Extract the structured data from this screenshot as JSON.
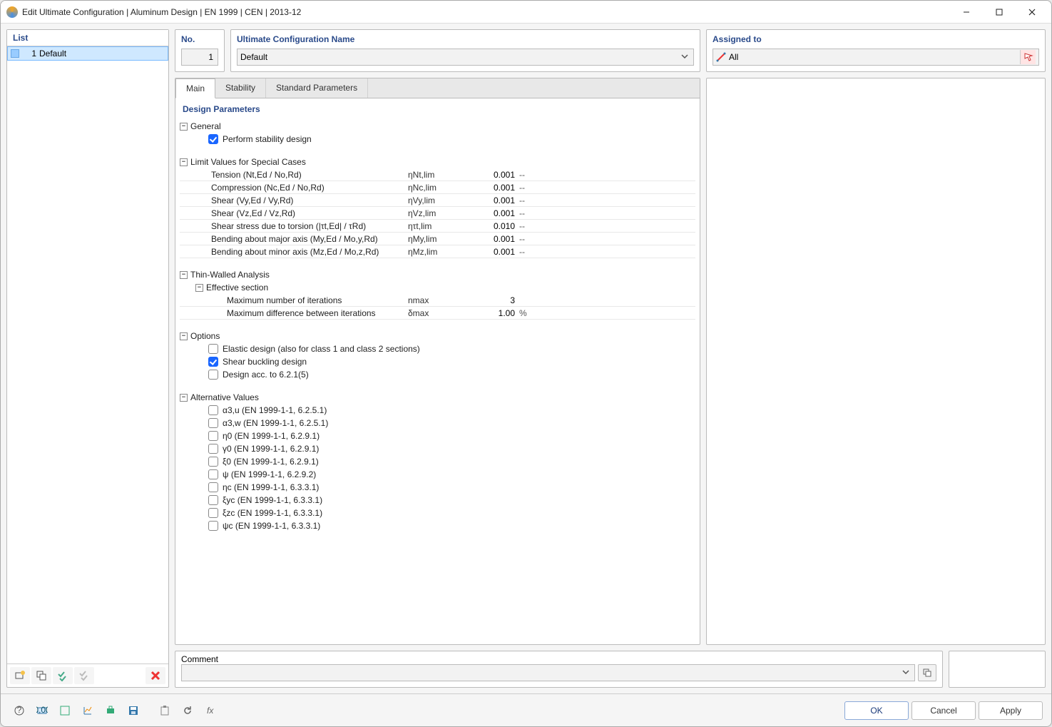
{
  "window": {
    "title": "Edit Ultimate Configuration | Aluminum Design | EN 1999 | CEN | 2013-12"
  },
  "left": {
    "header": "List",
    "items": [
      {
        "num": "1",
        "name": "Default",
        "selected": true
      }
    ]
  },
  "top": {
    "no_label": "No.",
    "no_value": "1",
    "name_label": "Ultimate Configuration Name",
    "name_value": "Default",
    "assigned_label": "Assigned to",
    "assigned_value": "All"
  },
  "tabs": [
    "Main",
    "Stability",
    "Standard Parameters"
  ],
  "params": {
    "title": "Design Parameters",
    "general": {
      "label": "General",
      "perform_stability": {
        "label": "Perform stability design",
        "checked": true
      }
    },
    "limit": {
      "label": "Limit Values for Special Cases",
      "rows": [
        {
          "name": "Tension (Nt,Ed / No,Rd)",
          "sym": "ηNt,lim",
          "val": "0.001",
          "unit": "--"
        },
        {
          "name": "Compression (Nc,Ed / No,Rd)",
          "sym": "ηNc,lim",
          "val": "0.001",
          "unit": "--"
        },
        {
          "name": "Shear (Vy,Ed / Vy,Rd)",
          "sym": "ηVy,lim",
          "val": "0.001",
          "unit": "--"
        },
        {
          "name": "Shear (Vz,Ed / Vz,Rd)",
          "sym": "ηVz,lim",
          "val": "0.001",
          "unit": "--"
        },
        {
          "name": "Shear stress due to torsion (|τt,Ed| / τRd)",
          "sym": "ητt,lim",
          "val": "0.010",
          "unit": "--"
        },
        {
          "name": "Bending about major axis (My,Ed / Mo,y,Rd)",
          "sym": "ηMy,lim",
          "val": "0.001",
          "unit": "--"
        },
        {
          "name": "Bending about minor axis (Mz,Ed / Mo,z,Rd)",
          "sym": "ηMz,lim",
          "val": "0.001",
          "unit": "--"
        }
      ]
    },
    "thin": {
      "label": "Thin-Walled Analysis",
      "eff_label": "Effective section",
      "rows": [
        {
          "name": "Maximum number of iterations",
          "sym": "nmax",
          "val": "3",
          "unit": ""
        },
        {
          "name": "Maximum difference between iterations",
          "sym": "δmax",
          "val": "1.00",
          "unit": "%"
        }
      ]
    },
    "options": {
      "label": "Options",
      "rows": [
        {
          "label": "Elastic design (also for class 1 and class 2 sections)",
          "checked": false
        },
        {
          "label": "Shear buckling design",
          "checked": true
        },
        {
          "label": "Design acc. to 6.2.1(5)",
          "checked": false
        }
      ]
    },
    "alt": {
      "label": "Alternative Values",
      "rows": [
        {
          "label": "α3,u (EN 1999-1-1, 6.2.5.1)",
          "checked": false
        },
        {
          "label": "α3,w (EN 1999-1-1, 6.2.5.1)",
          "checked": false
        },
        {
          "label": "η0 (EN 1999-1-1, 6.2.9.1)",
          "checked": false
        },
        {
          "label": "γ0 (EN 1999-1-1, 6.2.9.1)",
          "checked": false
        },
        {
          "label": "ξ0 (EN 1999-1-1, 6.2.9.1)",
          "checked": false
        },
        {
          "label": "ψ (EN 1999-1-1, 6.2.9.2)",
          "checked": false
        },
        {
          "label": "ηc (EN 1999-1-1, 6.3.3.1)",
          "checked": false
        },
        {
          "label": "ξyc (EN 1999-1-1, 6.3.3.1)",
          "checked": false
        },
        {
          "label": "ξzc (EN 1999-1-1, 6.3.3.1)",
          "checked": false
        },
        {
          "label": "ψc (EN 1999-1-1, 6.3.3.1)",
          "checked": false
        }
      ]
    }
  },
  "comment": {
    "label": "Comment",
    "value": ""
  },
  "footer": {
    "ok": "OK",
    "cancel": "Cancel",
    "apply": "Apply"
  }
}
